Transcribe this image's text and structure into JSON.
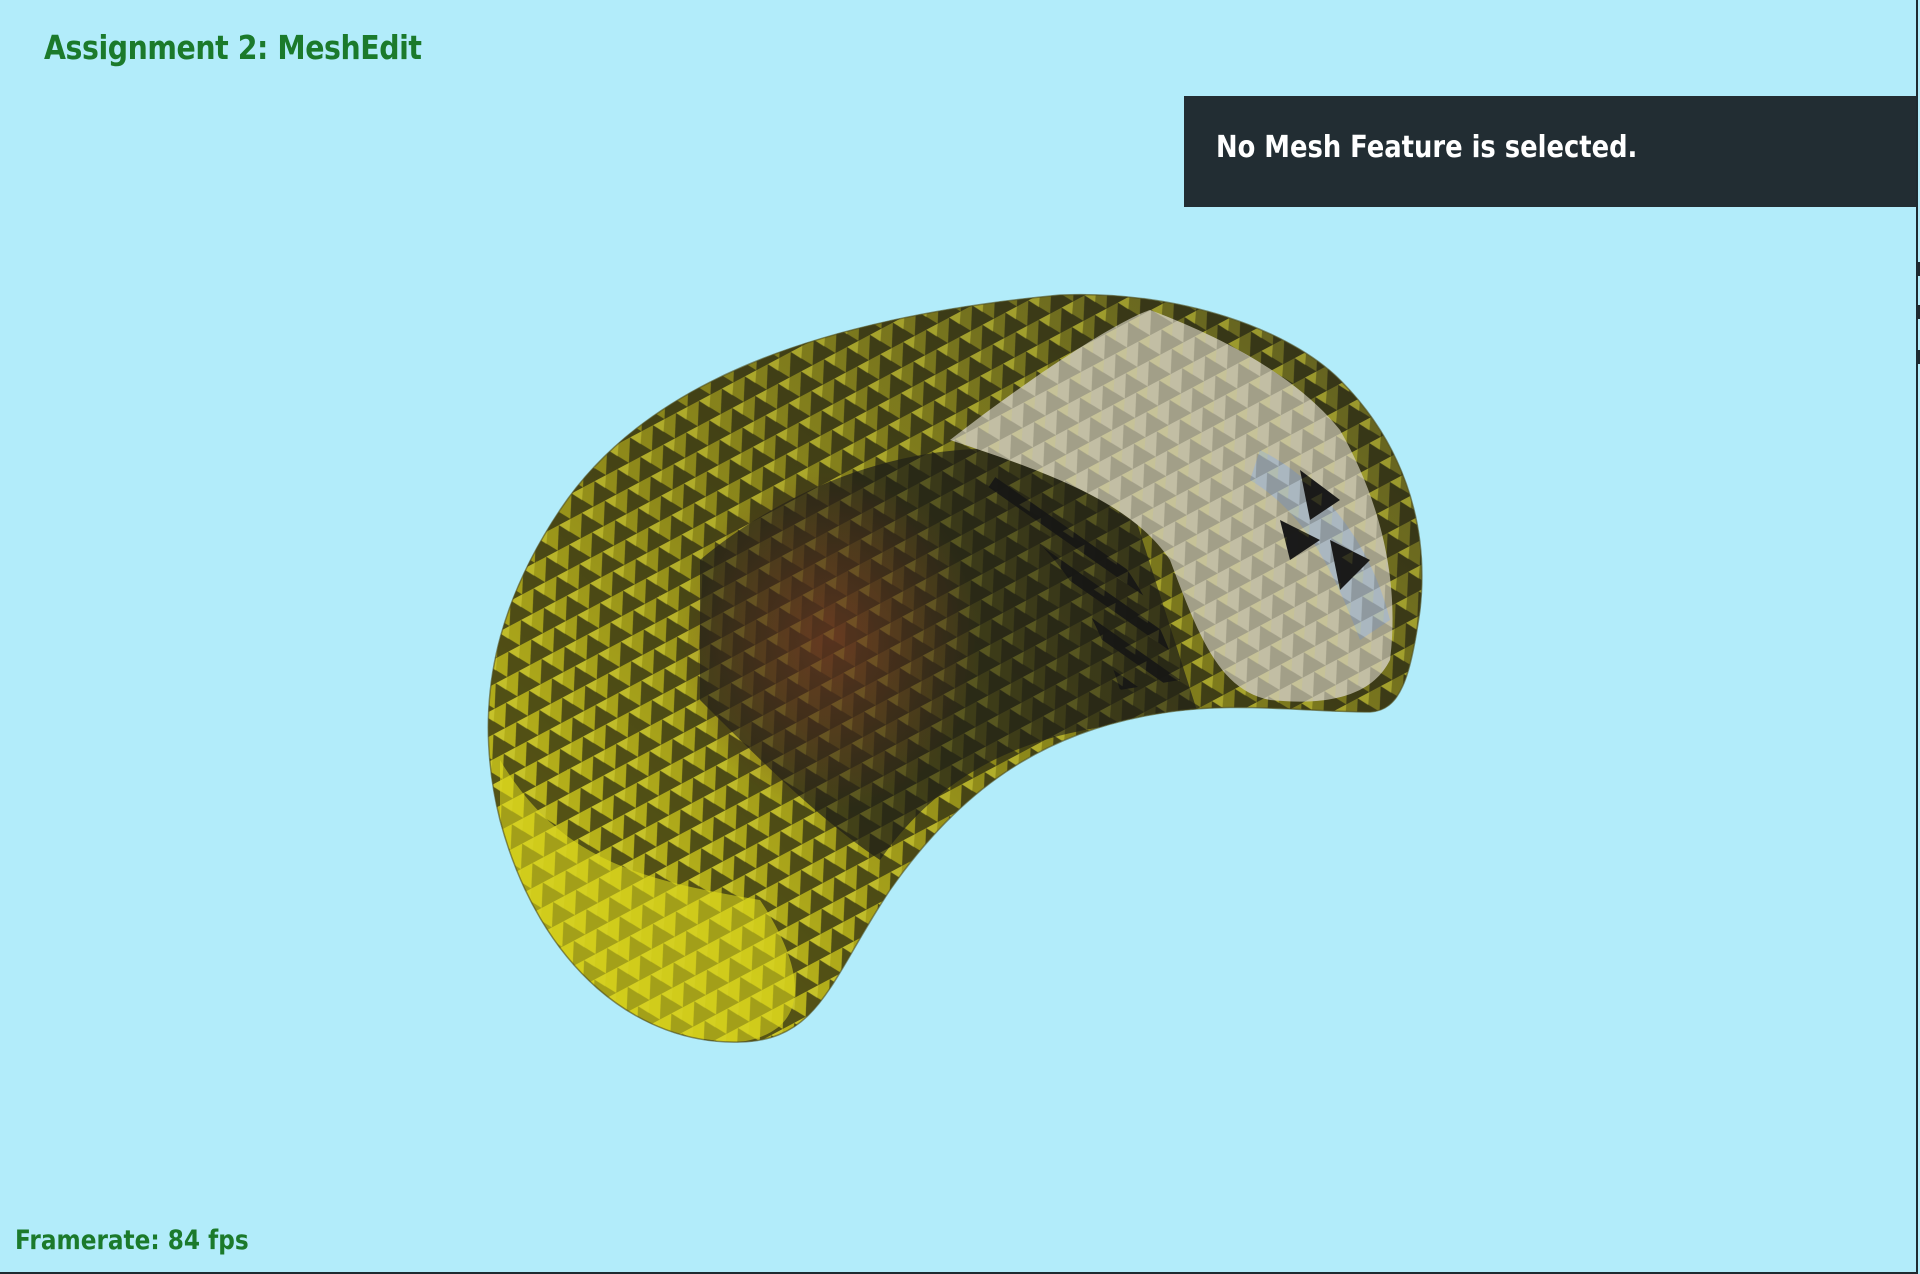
{
  "app": {
    "title": "Assignment 2: MeshEdit"
  },
  "info_panel": {
    "message": "No Mesh Feature is selected."
  },
  "status": {
    "framerate": "Framerate: 84 fps"
  },
  "colors": {
    "background": "#b2ecfa",
    "title_green": "#1b7a2b",
    "panel_bg": "#222d33",
    "mesh_yellow": "#c8c21a",
    "mesh_dark": "#1c1c14",
    "mesh_bone": "#c2bea4"
  }
}
